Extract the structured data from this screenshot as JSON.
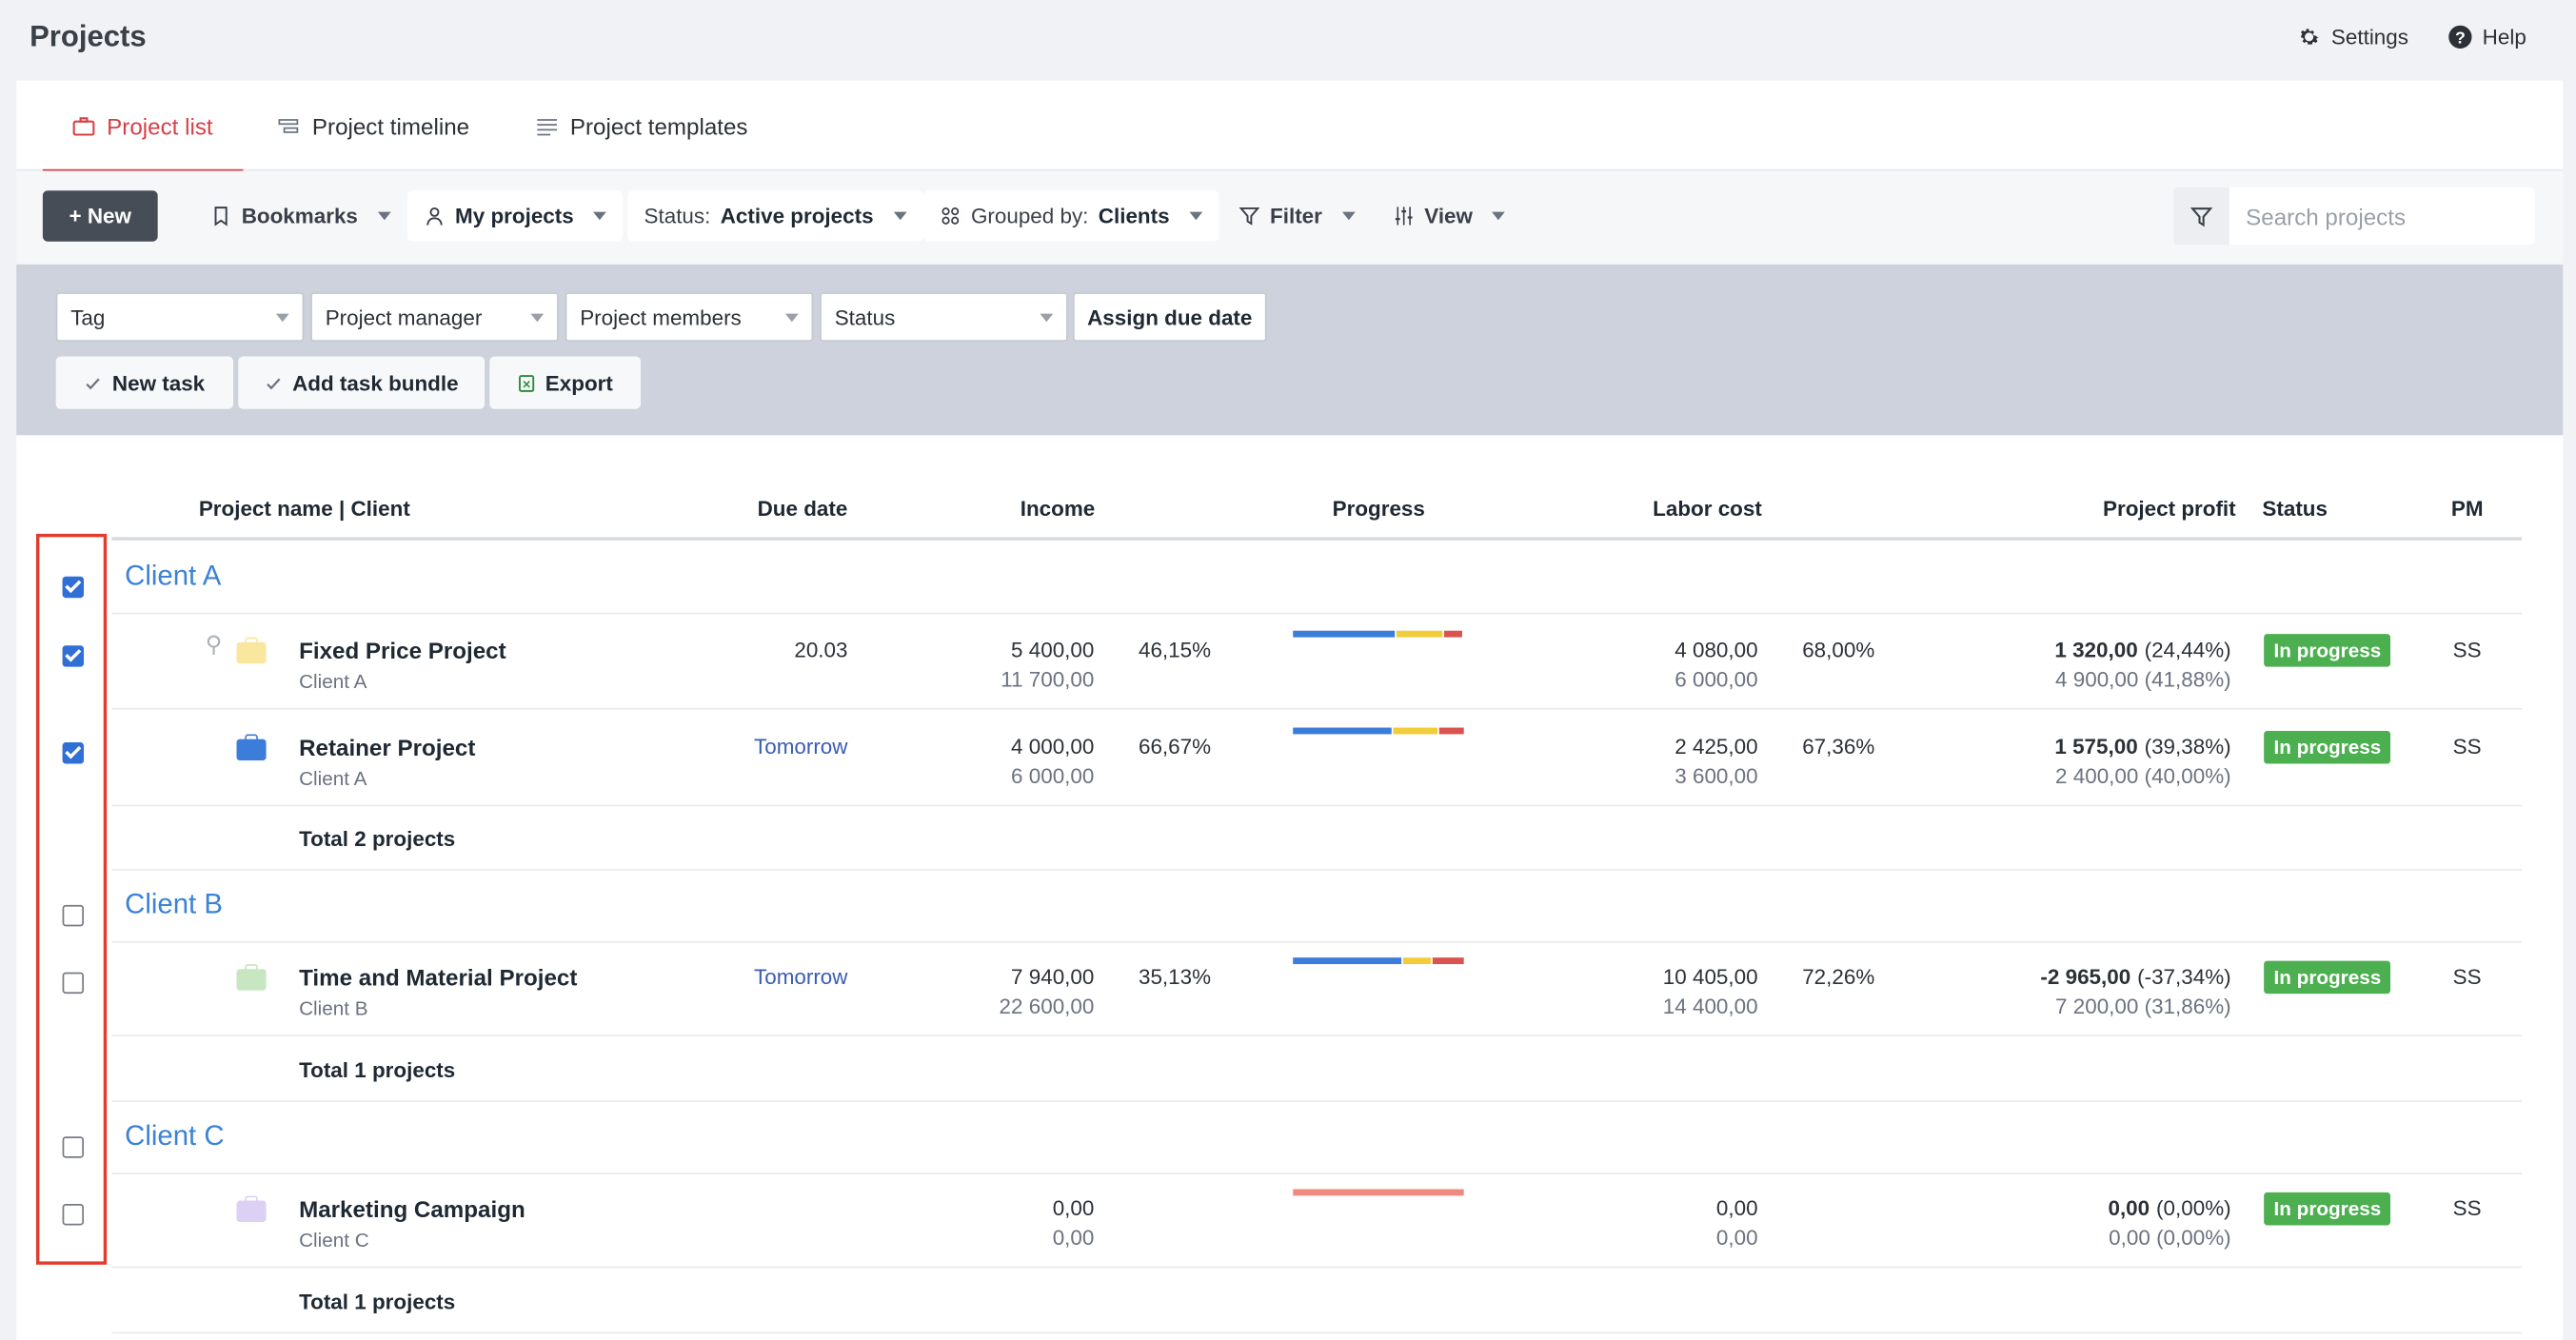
{
  "app": {
    "title": "Projects",
    "settings_label": "Settings",
    "help_label": "Help"
  },
  "tabs": [
    {
      "label": "Project list",
      "icon": "briefcase-icon",
      "active": true
    },
    {
      "label": "Project timeline",
      "icon": "timeline-icon",
      "active": false
    },
    {
      "label": "Project templates",
      "icon": "template-list-icon",
      "active": false
    }
  ],
  "toolbar": {
    "new_label": "+ New",
    "bookmarks_label": "Bookmarks",
    "my_projects_label": "My projects",
    "status_prefix": "Status:",
    "status_value": "Active projects",
    "grouped_prefix": "Grouped by:",
    "grouped_value": "Clients",
    "filter_label": "Filter",
    "view_label": "View",
    "search_placeholder": "Search projects"
  },
  "bulk": {
    "tag": "Tag",
    "project_manager": "Project manager",
    "project_members": "Project members",
    "status": "Status",
    "assign_due_date": "Assign due date",
    "new_task": "New task",
    "add_task_bundle": "Add task bundle",
    "export": "Export"
  },
  "columns": {
    "name": "Project name | Client",
    "due_date": "Due date",
    "income": "Income",
    "progress": "Progress",
    "labor_cost": "Labor cost",
    "project_profit": "Project profit",
    "status": "Status",
    "pm": "PM"
  },
  "groups": [
    {
      "client": "Client A",
      "checked": true,
      "total": "Total 2 projects",
      "projects": [
        {
          "name": "Fixed Price Project",
          "client": "Client A",
          "checked": true,
          "due": "20.03",
          "income": "5 400,00",
          "income_sub": "11 700,00",
          "income_pct": "46,15%",
          "labor": "4 080,00",
          "labor_sub": "6 000,00",
          "labor_pct": "68,00%",
          "profit": "1 320,00",
          "profit_pct": "(24,44%)",
          "profit_sub": "4 900,00 (41,88%)",
          "status": "In progress",
          "pm": "SS",
          "color": "#f9e79f",
          "progress": {
            "blue": 0.6,
            "yellow": 0.27,
            "red": 0.1
          }
        },
        {
          "name": "Retainer Project",
          "client": "Client A",
          "checked": true,
          "due": "Tomorrow",
          "income": "4 000,00",
          "income_sub": "6 000,00",
          "income_pct": "66,67%",
          "labor": "2 425,00",
          "labor_sub": "3 600,00",
          "labor_pct": "67,36%",
          "profit": "1 575,00",
          "profit_pct": "(39,38%)",
          "profit_sub": "2 400,00 (40,00%)",
          "status": "In progress",
          "pm": "SS",
          "color": "#3b7dd8",
          "progress": {
            "blue": 0.58,
            "yellow": 0.26,
            "red": 0.14
          }
        }
      ]
    },
    {
      "client": "Client B",
      "checked": false,
      "total": "Total 1 projects",
      "projects": [
        {
          "name": "Time and Material Project",
          "client": "Client B",
          "checked": false,
          "due": "Tomorrow",
          "income": "7 940,00",
          "income_sub": "22 600,00",
          "income_pct": "35,13%",
          "labor": "10 405,00",
          "labor_sub": "14 400,00",
          "labor_pct": "72,26%",
          "profit": "-2 965,00",
          "profit_pct": "(-37,34%)",
          "profit_sub": "7 200,00 (31,86%)",
          "status": "In progress",
          "pm": "SS",
          "color": "#c8e6c0",
          "progress": {
            "blue": 0.63,
            "yellow": 0.17,
            "red": 0.18
          }
        }
      ]
    },
    {
      "client": "Client C",
      "checked": false,
      "total": "Total 1 projects",
      "projects": [
        {
          "name": "Marketing Campaign",
          "client": "Client C",
          "checked": false,
          "due": "",
          "income": "0,00",
          "income_sub": "0,00",
          "income_pct": "",
          "labor": "0,00",
          "labor_sub": "0,00",
          "labor_pct": "",
          "profit": "0,00",
          "profit_pct": "(0,00%)",
          "profit_sub": "0,00 (0,00%)",
          "status": "In progress",
          "pm": "SS",
          "color": "#ddd0f5",
          "progress": {
            "salmon": 1.0
          }
        }
      ]
    }
  ],
  "colors": {
    "accent": "#d64045",
    "client_link": "#3b82d6",
    "status_green": "#4caf50",
    "progress_blue": "#3b7dd8",
    "progress_yellow": "#f2cd3a",
    "progress_red": "#d9534f",
    "progress_salmon": "#f08a80",
    "highlight": "#e23c2f"
  }
}
